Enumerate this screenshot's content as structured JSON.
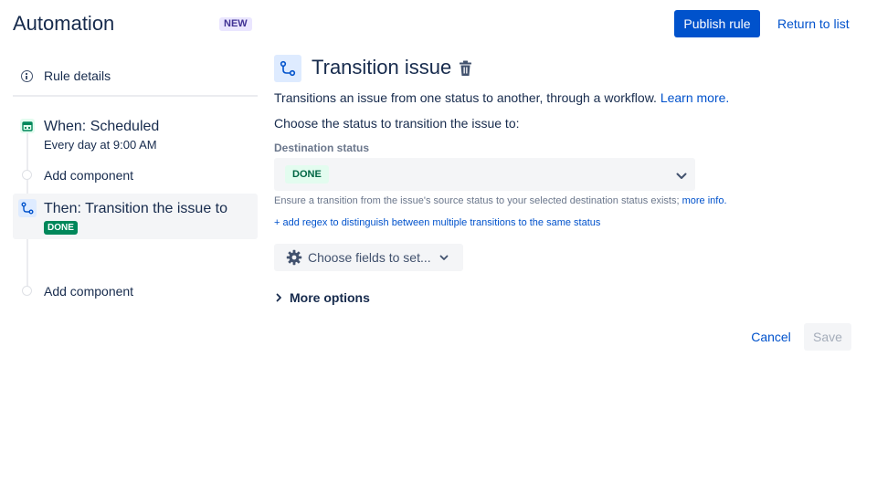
{
  "header": {
    "app_title": "Automation",
    "new_badge": "NEW",
    "publish_label": "Publish rule",
    "return_label": "Return to list"
  },
  "sidebar": {
    "rule_details": "Rule details",
    "trigger": {
      "title": "When: Scheduled",
      "subtitle": "Every day at 9:00 AM",
      "icon": "calendar-icon"
    },
    "add_component_1": "Add component",
    "action": {
      "title": "Then: Transition the issue to",
      "status": "DONE",
      "icon": "transition-icon"
    },
    "add_component_2": "Add component"
  },
  "main": {
    "title": "Transition issue",
    "description": "Transitions an issue from one status to another, through a workflow.",
    "learn_more": "Learn more.",
    "choose_label": "Choose the status to transition the issue to:",
    "destination_label": "Destination status",
    "destination_value": "DONE",
    "hint": "Ensure a transition from the issue's source status to your selected destination status exists;",
    "hint_link": "more info.",
    "regex_link": "+ add regex to distinguish between multiple transitions to the same status",
    "choose_fields": "Choose fields to set...",
    "more_options": "More options",
    "cancel_label": "Cancel",
    "save_label": "Save"
  },
  "colors": {
    "primary": "#0052cc",
    "done_dark": "#00875a",
    "done_light_bg": "#e3fcef",
    "new_badge_bg": "#eae6ff"
  }
}
